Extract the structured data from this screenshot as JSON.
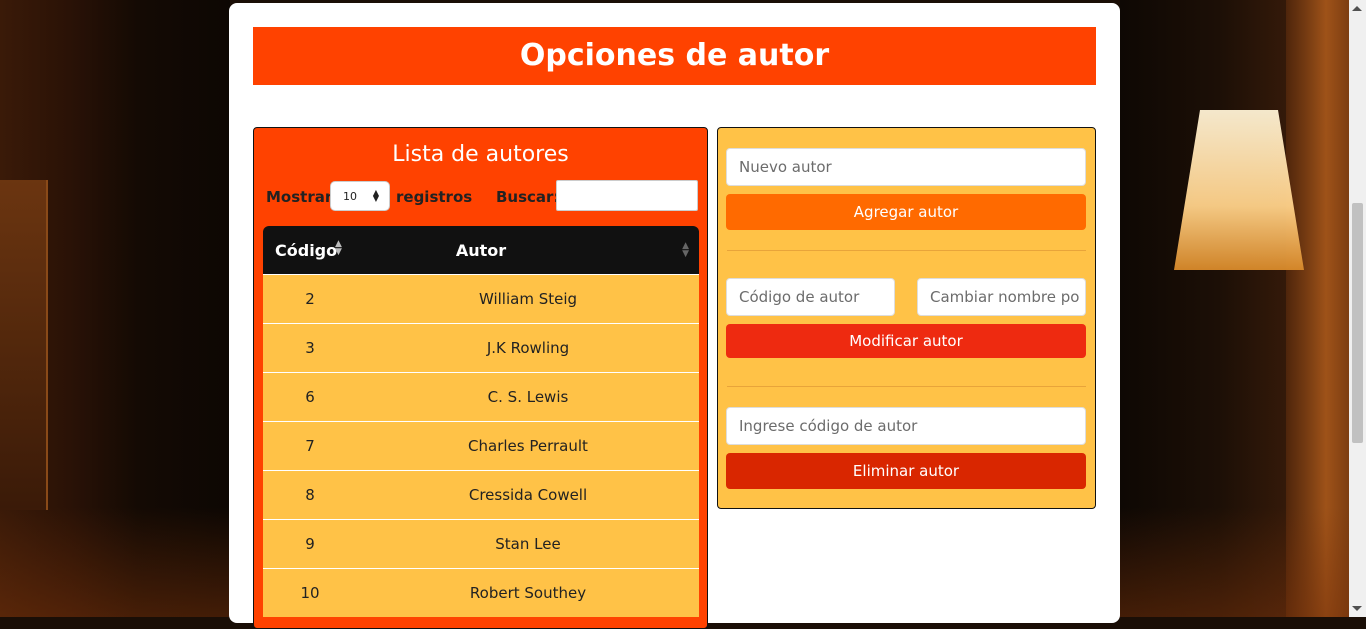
{
  "page": {
    "title": "Opciones de autor"
  },
  "list": {
    "title": "Lista de autores",
    "show_label": "Mostrar",
    "show_value": "10",
    "records_label": "registros",
    "search_label": "Buscar:",
    "search_value": "",
    "columns": [
      "Código",
      "Autor"
    ],
    "rows": [
      {
        "code": "2",
        "author": "William Steig"
      },
      {
        "code": "3",
        "author": "J.K Rowling"
      },
      {
        "code": "6",
        "author": "C. S. Lewis"
      },
      {
        "code": "7",
        "author": "Charles Perrault"
      },
      {
        "code": "8",
        "author": "Cressida Cowell"
      },
      {
        "code": "9",
        "author": "Stan Lee"
      },
      {
        "code": "10",
        "author": "Robert Southey"
      }
    ]
  },
  "form": {
    "new_author_placeholder": "Nuevo autor",
    "add_button": "Agregar autor",
    "code_placeholder": "Código de autor",
    "rename_placeholder": "Cambiar nombre po",
    "modify_button": "Modificar autor",
    "delete_code_placeholder": "Ingrese código de autor",
    "delete_button": "Eliminar autor"
  },
  "colors": {
    "title_bg": "#ff4200",
    "panel_yellow": "#ffc247",
    "add_button": "#ff6a00",
    "modify_button": "#ee2a10",
    "delete_button": "#d92600",
    "table_header": "#111111"
  }
}
